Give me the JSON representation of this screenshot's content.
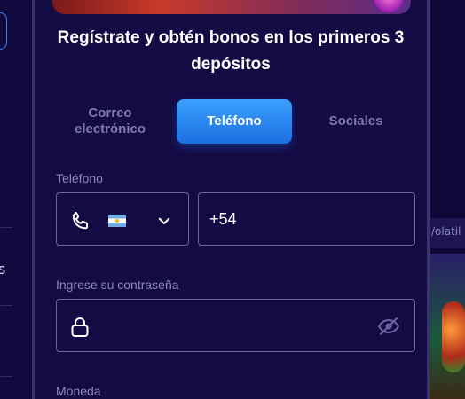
{
  "modal": {
    "title": "Regístrate y obtén bonos en los primeros 3 depósitos",
    "tabs": [
      {
        "label": "Correo electrónico",
        "active": false
      },
      {
        "label": "Teléfono",
        "active": true
      },
      {
        "label": "Sociales",
        "active": false
      }
    ],
    "phone": {
      "label": "Teléfono",
      "country_flag": "argentina-flag",
      "value": "+54"
    },
    "password": {
      "label": "Ingrese su contraseña",
      "value": ""
    },
    "currency": {
      "label": "Moneda"
    }
  },
  "background": {
    "right_strip_text": "/olatil",
    "left_edge_text": "s"
  },
  "colors": {
    "accent": "#1c6fe0",
    "modal_bg": "#140a44",
    "page_bg": "#0c0733",
    "field_border": "#6b66a0"
  },
  "icons": [
    "phone-icon",
    "argentina-flag-icon",
    "chevron-down-icon",
    "lock-icon",
    "eye-off-icon"
  ]
}
